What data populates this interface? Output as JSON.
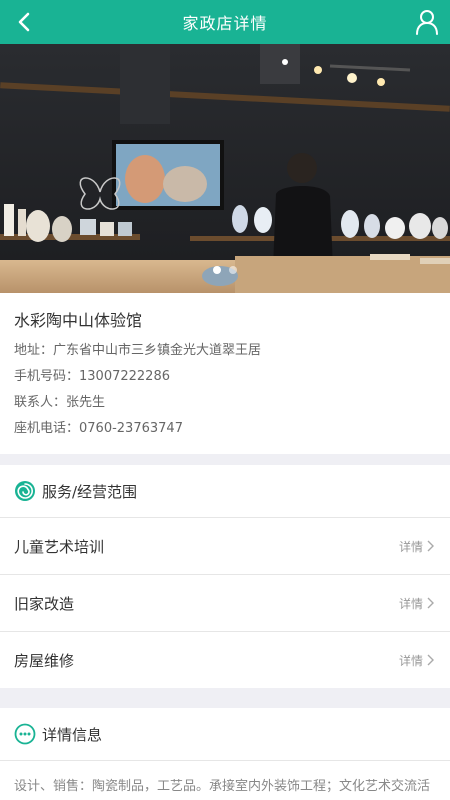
{
  "header": {
    "title": "家政店详情",
    "back_icon": "back-icon",
    "user_icon": "user-icon",
    "color": "#19b394"
  },
  "banner": {
    "slide_count": 2,
    "active_slide": 1
  },
  "store": {
    "name": "水彩陶中山体验馆",
    "address_label": "地址：",
    "address": "广东省中山市三乡镇金光大道翠王居",
    "mobile_label": "手机号码：",
    "mobile": "13007222286",
    "contact_label": "联系人：",
    "contact": "张先生",
    "phone_label": "座机电话：",
    "phone": "0760-23763747"
  },
  "services": {
    "title": "服务/经营范围",
    "detail_label": "详情",
    "items": [
      {
        "name": "儿童艺术培训"
      },
      {
        "name": "旧家改造"
      },
      {
        "name": "房屋维修"
      }
    ]
  },
  "details": {
    "title": "详情信息",
    "text": "设计、销售：陶瓷制品，工艺品。承接室内外装饰工程；文化艺术交流活"
  }
}
